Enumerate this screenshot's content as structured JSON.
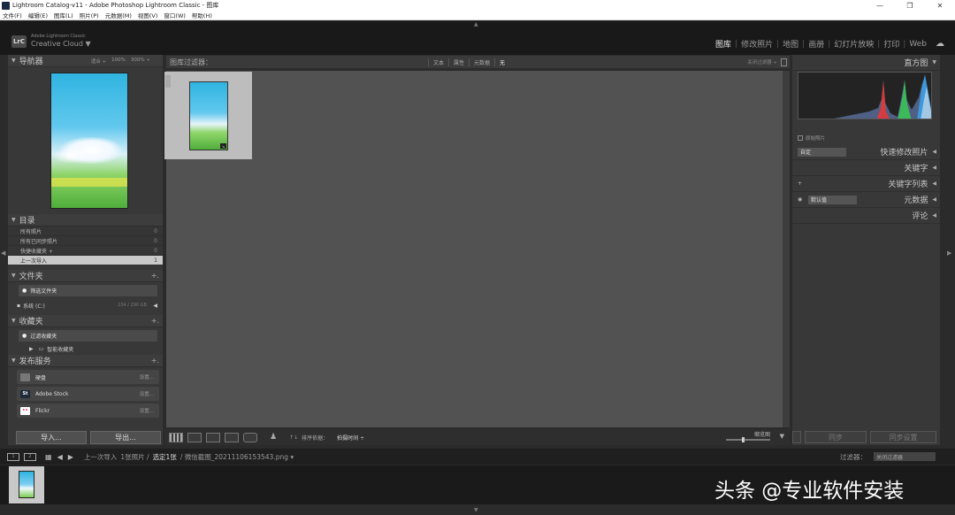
{
  "window": {
    "title": "Lightroom Catalog-v11 - Adobe Photoshop Lightroom Classic - 图库",
    "controls": [
      "—",
      "❐",
      "✕"
    ]
  },
  "menu": [
    "文件(F)",
    "编辑(E)",
    "图库(L)",
    "照片(P)",
    "元数据(M)",
    "视图(V)",
    "窗口(W)",
    "帮助(H)"
  ],
  "identity": {
    "badge": "LrC",
    "small": "Adobe Lightroom Classic",
    "big": "Creative Cloud ▼"
  },
  "modules": [
    "图库",
    "修改照片",
    "地图",
    "画册",
    "幻灯片放映",
    "打印",
    "Web"
  ],
  "left": {
    "navigator": {
      "title": "导航器",
      "zooms": [
        "适合 ÷",
        "100%",
        "300% ÷"
      ]
    },
    "catalog": {
      "title": "目录",
      "rows": [
        {
          "label": "所有照片",
          "count": "0"
        },
        {
          "label": "所有已同步照片",
          "count": "0"
        },
        {
          "label": "快捷收藏夹 +",
          "count": "0"
        },
        {
          "label": "上一次导入",
          "count": "1"
        }
      ]
    },
    "folders": {
      "title": "文件夹",
      "filter": "筛选文件夹",
      "disk": "系统 (C:)",
      "disk_size": "234 / 290 GB"
    },
    "collections": {
      "title": "收藏夹",
      "filter": "过滤收藏夹",
      "smart": "智能收藏夹"
    },
    "publish": {
      "title": "发布服务",
      "services": [
        {
          "logo": "",
          "name": "硬盘",
          "action": "设置..."
        },
        {
          "logo": "St",
          "name": "Adobe Stock",
          "action": "设置..."
        },
        {
          "logo": "••",
          "name": "Flickr",
          "action": "设置..."
        }
      ]
    },
    "import_label": "导入...",
    "export_label": "导出..."
  },
  "center": {
    "filter_title": "图库过滤器：",
    "filter_opts": [
      "文本",
      "属性",
      "元数据",
      "无"
    ],
    "filter_preset": "关闭过滤器 ÷",
    "thumb_badge": "↘",
    "sort_label": "排序依据：",
    "sort_value": "拍摄时间 ÷",
    "thumbs_label": "缩览图"
  },
  "right": {
    "histogram": "直方图",
    "original": "原始照片",
    "quick_develop": "快速修改照片",
    "qd_preset": "自定",
    "keywords": "关键字",
    "keyword_list": "关键字列表",
    "metadata": "元数据",
    "md_preset": "默认值",
    "comments": "评论",
    "sync_label": "同步",
    "sync_settings": "同步设置"
  },
  "filmstrip": {
    "crumb_parts": [
      "上一次导入",
      "1张照片 /",
      "选定1张",
      "/ 微信截图_20211106153543.png ▾"
    ],
    "filter_label": "过滤器：",
    "filter_value": "关闭过滤器"
  },
  "watermark": "头条 @专业软件安装",
  "colors": {
    "accent": "#c9c9c9",
    "panel": "#383838",
    "grid": "#525252"
  }
}
